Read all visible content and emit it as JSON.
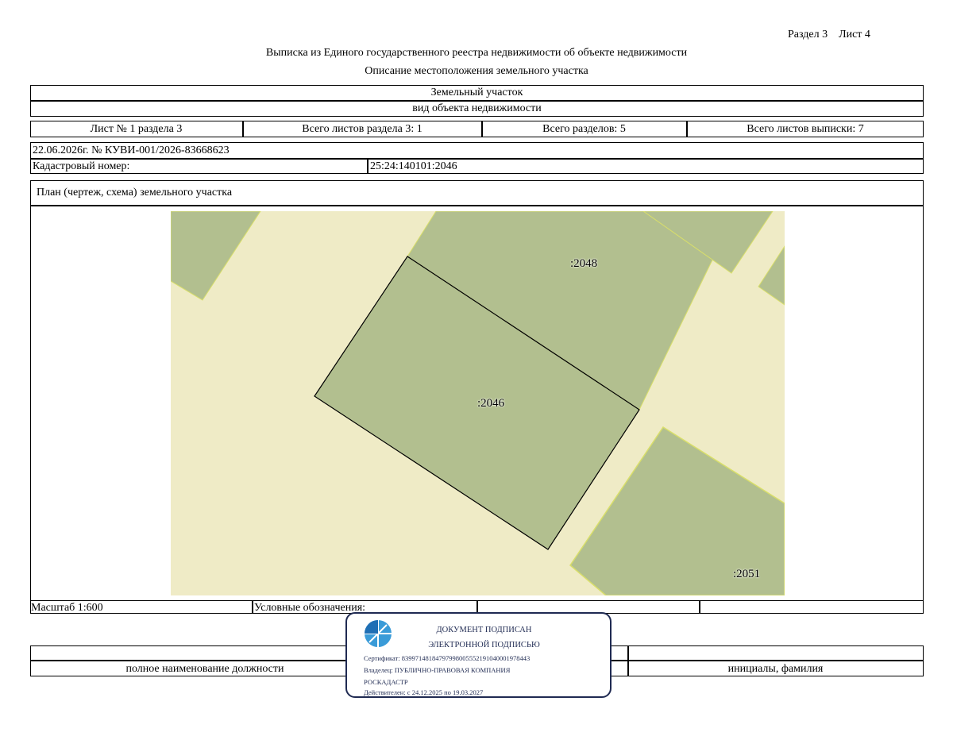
{
  "header": {
    "section_sheet": "Раздел 3    Лист 4",
    "title": "Выписка из Единого государственного реестра недвижимости об объекте недвижимости",
    "subtitle": "Описание местоположения земельного участка"
  },
  "object": {
    "type": "Земельный участок",
    "type_caption": "вид объекта недвижимости"
  },
  "sheets": {
    "sheet_no": "Лист № 1 раздела 3",
    "total_section_sheets": "Всего листов раздела 3: 1",
    "total_sections": "Всего разделов: 5",
    "total_extract_sheets": "Всего листов выписки: 7"
  },
  "record": {
    "date_number": "22.06.2026г. № КУВИ-001/2026-83668623",
    "cadastral_label": "Кадастровый номер:",
    "cadastral_value": "25:24:140101:2046"
  },
  "plan": {
    "title": "План (чертеж, схема) земельного участка",
    "parcels": [
      {
        "label": ":2048"
      },
      {
        "label": ":2046"
      },
      {
        "label": ":2051"
      }
    ],
    "colors": {
      "background": "#efebc6",
      "parcel_fill": "#b2bf8f",
      "parcel_border": "#d9df6a",
      "subject_border": "#000000"
    }
  },
  "footer": {
    "scale": "Масштаб 1:600",
    "legend": "Условные обозначения:",
    "position_caption": "полное наименование должности",
    "name_caption": "инициалы, фамилия"
  },
  "stamp": {
    "line1": "ДОКУМЕНТ ПОДПИСАН",
    "line2": "ЭЛЕКТРОННОЙ ПОДПИСЬЮ",
    "certificate": "Сертификат: 83997148184797998005552191040001978443",
    "owner_line1": "Владелец: ПУБЛИЧНО-ПРАВОВАЯ КОМПАНИЯ",
    "owner_line2": "РОСКАДАСТР",
    "valid": "Действителен: с 24.12.2025 по 19.03.2027",
    "logo": "roskadastr-logo",
    "color": "#1f2a52"
  }
}
